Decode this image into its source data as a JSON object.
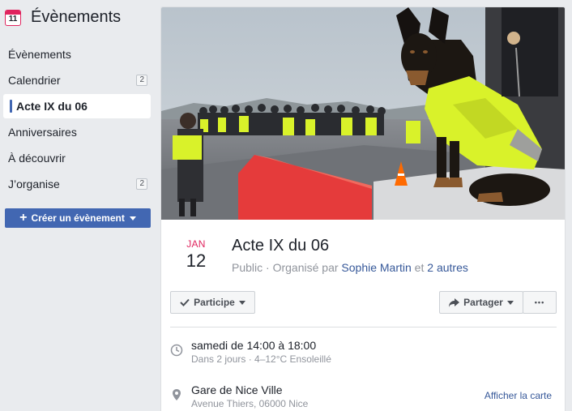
{
  "sidebar": {
    "title": "Évènements",
    "calendar_icon_number": "11",
    "items": [
      {
        "label": "Évènements",
        "badge": ""
      },
      {
        "label": "Calendrier",
        "badge": "2"
      },
      {
        "label": "Acte IX du 06",
        "badge": ""
      },
      {
        "label": "Anniversaires",
        "badge": ""
      },
      {
        "label": "À découvrir",
        "badge": ""
      },
      {
        "label": "J’organise",
        "badge": "2"
      }
    ],
    "create_button": "Créer un évènement"
  },
  "event": {
    "month": "JAN",
    "day": "12",
    "title": "Acte IX du 06",
    "privacy": "Public",
    "organized_by": " · Organisé par ",
    "organizer": "Sophie Martin",
    "and_text": " et ",
    "others": "2 autres"
  },
  "actions": {
    "going_label": "Participe",
    "share_label": "Partager",
    "more_label": "•••"
  },
  "details": {
    "time_main": "samedi de 14:00 à 18:00",
    "time_secondary": "Dans 2 jours · 4–12°C Ensoleillé",
    "location_main": "Gare de Nice Ville",
    "location_secondary": "Avenue Thiers, 06000 Nice",
    "map_link": "Afficher la carte"
  },
  "colors": {
    "accent": "#4267b2",
    "link": "#365899",
    "date_red": "#e0245e",
    "vest_yellow": "#d9f22a"
  },
  "icons": {
    "calendar": "calendar-icon",
    "clock": "clock-icon",
    "location": "map-pin-icon",
    "check": "check-icon",
    "share": "share-arrow-icon",
    "plus": "plus-icon"
  }
}
